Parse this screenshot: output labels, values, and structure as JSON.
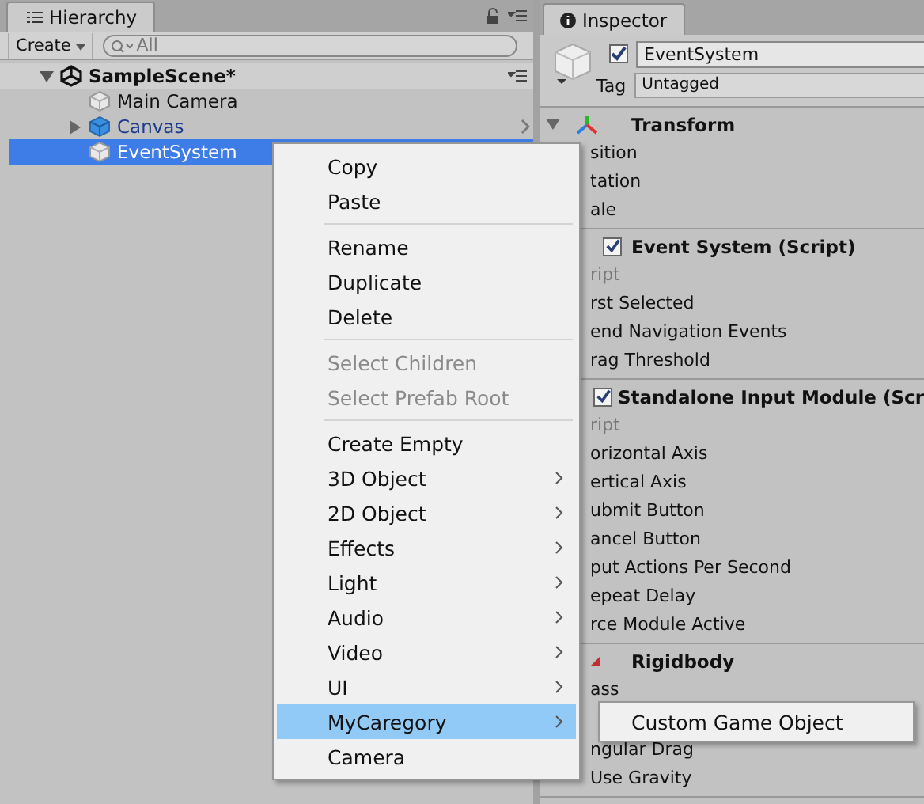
{
  "hierarchy": {
    "tab": "Hierarchy",
    "create": "Create",
    "search": {
      "placeholder": "All"
    },
    "scene": {
      "name": "SampleScene*",
      "expanded": true,
      "children": [
        {
          "name": "Main Camera",
          "prefab": false,
          "selected": false,
          "has_children": false
        },
        {
          "name": "Canvas",
          "prefab": true,
          "selected": false,
          "has_children": true
        },
        {
          "name": "EventSystem",
          "prefab": false,
          "selected": true,
          "has_children": false
        }
      ]
    }
  },
  "inspector": {
    "tab": "Inspector",
    "object": {
      "active": true,
      "name": "EventSystem",
      "tag_label": "Tag",
      "tag": "Untagged"
    },
    "components": [
      {
        "title": "Transform",
        "kind": "transform",
        "expanded": true,
        "fields": [
          "sition",
          "tation",
          "ale"
        ]
      },
      {
        "title": "Event System (Script)",
        "kind": "script",
        "enabled": true,
        "fields": [
          "ript",
          "rst Selected",
          "end Navigation Events",
          "rag Threshold"
        ]
      },
      {
        "title": "Standalone Input Module (Scr",
        "kind": "script",
        "enabled": true,
        "fields": [
          "ript",
          "orizontal Axis",
          "ertical Axis",
          "ubmit Button",
          "ancel Button",
          "put Actions Per Second",
          "epeat Delay",
          "rce Module Active"
        ]
      },
      {
        "title": "Rigidbody",
        "kind": "rigidbody",
        "fields": [
          "ass",
          "ngular Drag",
          "Use Gravity"
        ]
      }
    ]
  },
  "context_menu": {
    "items": [
      {
        "kind": "item",
        "label": "Copy",
        "disabled": false,
        "submenu": false,
        "selected": false
      },
      {
        "kind": "item",
        "label": "Paste",
        "disabled": false,
        "submenu": false,
        "selected": false
      },
      {
        "kind": "separator"
      },
      {
        "kind": "item",
        "label": "Rename",
        "disabled": false,
        "submenu": false,
        "selected": false
      },
      {
        "kind": "item",
        "label": "Duplicate",
        "disabled": false,
        "submenu": false,
        "selected": false
      },
      {
        "kind": "item",
        "label": "Delete",
        "disabled": false,
        "submenu": false,
        "selected": false
      },
      {
        "kind": "separator"
      },
      {
        "kind": "item",
        "label": "Select Children",
        "disabled": true,
        "submenu": false,
        "selected": false
      },
      {
        "kind": "item",
        "label": "Select Prefab Root",
        "disabled": true,
        "submenu": false,
        "selected": false
      },
      {
        "kind": "separator"
      },
      {
        "kind": "item",
        "label": "Create Empty",
        "disabled": false,
        "submenu": false,
        "selected": false
      },
      {
        "kind": "item",
        "label": "3D Object",
        "disabled": false,
        "submenu": true,
        "selected": false
      },
      {
        "kind": "item",
        "label": "2D Object",
        "disabled": false,
        "submenu": true,
        "selected": false
      },
      {
        "kind": "item",
        "label": "Effects",
        "disabled": false,
        "submenu": true,
        "selected": false
      },
      {
        "kind": "item",
        "label": "Light",
        "disabled": false,
        "submenu": true,
        "selected": false
      },
      {
        "kind": "item",
        "label": "Audio",
        "disabled": false,
        "submenu": true,
        "selected": false
      },
      {
        "kind": "item",
        "label": "Video",
        "disabled": false,
        "submenu": true,
        "selected": false
      },
      {
        "kind": "item",
        "label": "UI",
        "disabled": false,
        "submenu": true,
        "selected": false
      },
      {
        "kind": "item",
        "label": "MyCaregory",
        "disabled": false,
        "submenu": true,
        "selected": true
      },
      {
        "kind": "item",
        "label": "Camera",
        "disabled": false,
        "submenu": false,
        "selected": false
      }
    ],
    "submenu": [
      {
        "label": "Custom Game Object",
        "selected": false
      }
    ]
  }
}
